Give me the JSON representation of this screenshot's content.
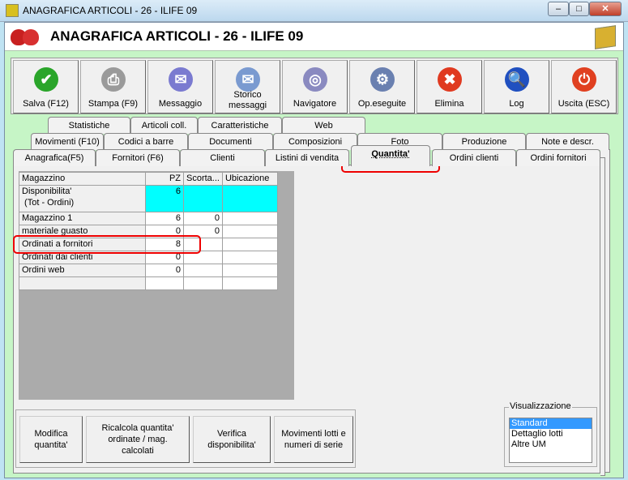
{
  "window": {
    "title": "ANAGRAFICA ARTICOLI - 26 - ILIFE 09",
    "controls": [
      "minimize",
      "maximize",
      "close"
    ]
  },
  "header": {
    "title": "ANAGRAFICA ARTICOLI - 26 - ILIFE 09"
  },
  "toolbar": [
    {
      "label": "Salva (F12)",
      "icon": "check-icon",
      "color": "#2aa52a",
      "glyph": "✔"
    },
    {
      "label": "Stampa (F9)",
      "icon": "printer-icon",
      "color": "#9a9a9a",
      "glyph": "⎙"
    },
    {
      "label": "Messaggio",
      "icon": "envelope-pen-icon",
      "color": "#7a7ad0",
      "glyph": "✉"
    },
    {
      "label": "Storico messaggi",
      "icon": "envelope-search-icon",
      "color": "#7a9ad0",
      "glyph": "✉"
    },
    {
      "label": "Navigatore",
      "icon": "compass-icon",
      "color": "#8a8ac0",
      "glyph": "◎"
    },
    {
      "label": "Op.eseguite",
      "icon": "gears-search-icon",
      "color": "#6a80b0",
      "glyph": "⚙"
    },
    {
      "label": "Elimina",
      "icon": "delete-x-icon",
      "color": "#e03a20",
      "glyph": "✖"
    },
    {
      "label": "Log",
      "icon": "book-search-icon",
      "color": "#2050c0",
      "glyph": "🔍"
    },
    {
      "label": "Uscita (ESC)",
      "icon": "power-icon",
      "color": "#e04020",
      "glyph": "⏻"
    }
  ],
  "tabs": {
    "row1": [
      "Statistiche",
      "Articoli coll.",
      "Caratteristiche",
      "Web"
    ],
    "row2": [
      "Movimenti (F10)",
      "Codici a barre",
      "Documenti",
      "Composizioni",
      "Foto",
      "Produzione",
      "Note e descr."
    ],
    "row3": [
      "Anagrafica(F5)",
      "Fornitori (F6)",
      "Clienti",
      "Listini di vendita",
      "Quantita'",
      "Ordini clienti",
      "Ordini fornitori"
    ],
    "active": "Quantita'"
  },
  "grid": {
    "columns": [
      "Magazzino",
      "PZ",
      "Scorta...",
      "Ubicazione"
    ],
    "rows": [
      {
        "name": "Disponibilita'\n (Tot - Ordini)",
        "pz": "6",
        "scorta": "",
        "ubicazione": ""
      },
      {
        "name": "Magazzino 1",
        "pz": "6",
        "scorta": "0",
        "ubicazione": ""
      },
      {
        "name": "materiale guasto",
        "pz": "0",
        "scorta": "0",
        "ubicazione": ""
      },
      {
        "name": "Ordinati a fornitori",
        "pz": "8",
        "scorta": "",
        "ubicazione": ""
      },
      {
        "name": "Ordinati dai clienti",
        "pz": "0",
        "scorta": "",
        "ubicazione": ""
      },
      {
        "name": "Ordini web",
        "pz": "0",
        "scorta": "",
        "ubicazione": ""
      },
      {
        "name": "",
        "pz": "",
        "scorta": "",
        "ubicazione": ""
      }
    ],
    "highlight_color": "#00ffff"
  },
  "actions": [
    "Modifica quantita'",
    "Ricalcola quantita' ordinate / mag. calcolati",
    "Verifica disponibilita'",
    "Movimenti lotti e numeri di serie"
  ],
  "visualizzazione": {
    "label": "Visualizzazione",
    "options": [
      "Standard",
      "Dettaglio lotti",
      "Altre UM"
    ],
    "selected": "Standard"
  },
  "annotation_color": "#ee0000"
}
